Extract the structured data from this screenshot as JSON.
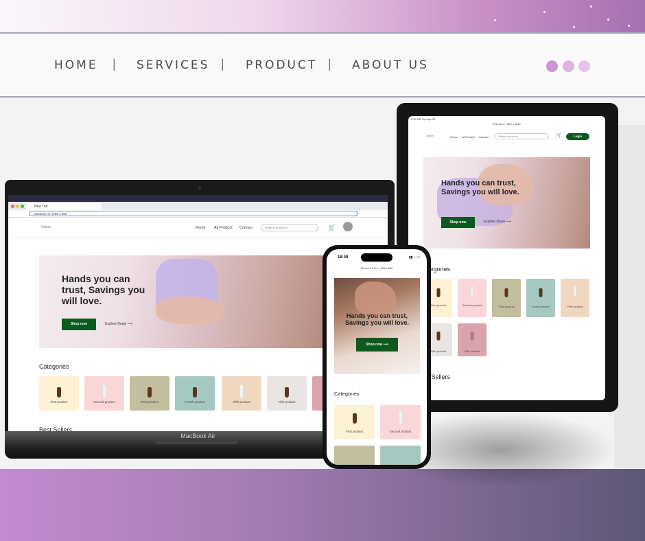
{
  "nav": {
    "home": "HOME",
    "services": "SERVICES",
    "product": "PRODUCT",
    "about": "ABOUT US",
    "separator": "|"
  },
  "colors": {
    "dot1": "#c995d0",
    "dot2": "#ddb5e0",
    "dot3": "#e7c3ea",
    "green": "#0b5a1f"
  },
  "site": {
    "logo": "Aslam",
    "links": [
      "Home",
      "All Product",
      "Contact"
    ],
    "search_placeholder": "Search products",
    "cart_count": "0",
    "login": "Login",
    "hero_title": "Hands you can trust, Savings you will love.",
    "shop_now": "Shop now",
    "explore": "Explore Deals",
    "categories_title": "Categories",
    "best_sellers": "Best Sellers",
    "phone_best_sellers": "st Sellers",
    "categories": [
      "First product",
      "Second product",
      "Third product",
      "Fourth product",
      "Fifth product",
      "Fifth product"
    ]
  },
  "laptop": {
    "tab_label": "New Tab",
    "address": "Macbook Air 1280 x 800",
    "device_label": "MacBook Air"
  },
  "tablet": {
    "status_time": "6:03 PM  Tue Apr 25",
    "device_label": "iPad Air 5 - 820 x 1180",
    "categories_title": "ategories",
    "best_sellers": "st Sellers"
  },
  "phone": {
    "time": "18:48",
    "device_label": "iPhone 14 Pro · 393 x 852",
    "hero_title": "Hands you can trust, Savings you will love."
  }
}
